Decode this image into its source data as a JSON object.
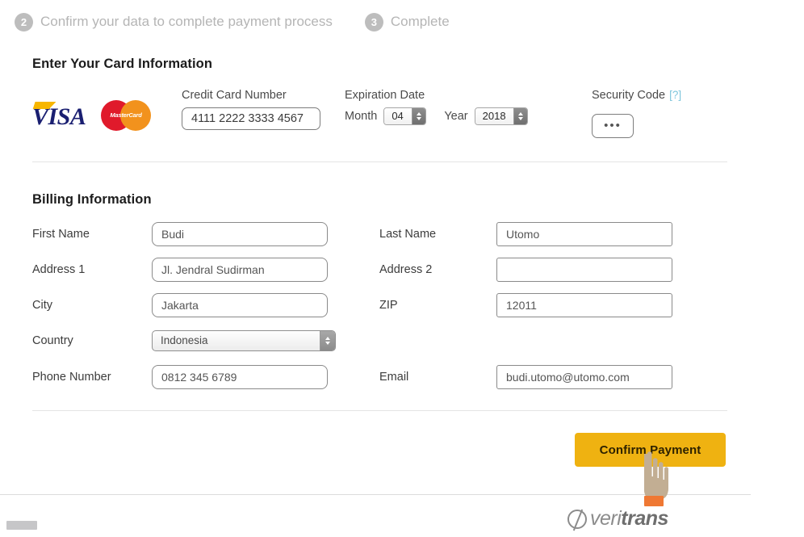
{
  "steps": [
    {
      "number": "2",
      "label": "Confirm your data to complete payment process"
    },
    {
      "number": "3",
      "label": "Complete"
    }
  ],
  "card_section": {
    "title": "Enter Your Card Information",
    "logos": {
      "visa": "VISA",
      "mastercard": "MasterCard"
    },
    "credit_card": {
      "label": "Credit Card Number",
      "value": "4111 2222 3333 4567"
    },
    "expiration": {
      "label": "Expiration Date",
      "month_label": "Month",
      "month_value": "04",
      "year_label": "Year",
      "year_value": "2018"
    },
    "security_code": {
      "label": "Security Code",
      "help": "[?]",
      "value": "•••"
    }
  },
  "billing_section": {
    "title": "Billing Information",
    "fields_left": [
      {
        "label": "First Name",
        "value": "Budi",
        "type": "text"
      },
      {
        "label": "Address 1",
        "value": "Jl. Jendral Sudirman",
        "type": "text"
      },
      {
        "label": "City",
        "value": "Jakarta",
        "type": "text"
      },
      {
        "label": "Country",
        "value": "Indonesia",
        "type": "select"
      },
      {
        "label": "Phone Number",
        "value": "0812 345 6789",
        "type": "text"
      }
    ],
    "fields_right": [
      {
        "label": "Last Name",
        "value": "Utomo",
        "type": "text"
      },
      {
        "label": "Address 2",
        "value": "",
        "type": "text"
      },
      {
        "label": "ZIP",
        "value": "12011",
        "type": "text"
      },
      {
        "label": "Email",
        "value": "budi.utomo@utomo.com",
        "type": "text"
      }
    ]
  },
  "actions": {
    "confirm_label": "Confirm Payment"
  },
  "footer": {
    "brand_prefix": "veri",
    "brand_suffix": "trans"
  },
  "colors": {
    "confirm_button": "#efb211",
    "step_badge": "#bdbdbd",
    "help_link": "#7fc6dc",
    "visa_blue": "#1a1f71",
    "visa_gold": "#f7b600",
    "mastercard_red": "#e01a2b",
    "mastercard_orange": "#f2921d",
    "veritrans_gray": "#8c8c8c"
  }
}
